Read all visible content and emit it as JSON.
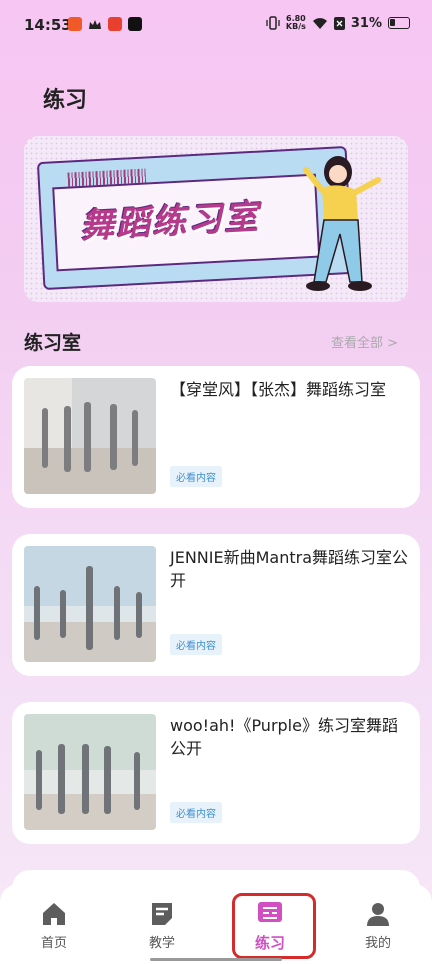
{
  "status_bar": {
    "time": "14:53",
    "net_speed_value": "6.80",
    "net_speed_unit": "KB/s",
    "battery": "31%"
  },
  "page": {
    "title": "练习"
  },
  "banner": {
    "text": "舞蹈练习室"
  },
  "section": {
    "title": "练习室",
    "view_all": "查看全部 >"
  },
  "cards": [
    {
      "title": "【穿堂风】【张杰】舞蹈练习室",
      "tag": "必看内容"
    },
    {
      "title": "JENNIE新曲Mantra舞蹈练习室公开",
      "tag": "必看内容"
    },
    {
      "title": "woo!ah!《Purple》练习室舞蹈公开",
      "tag": "必看内容"
    }
  ],
  "nav": {
    "items": [
      {
        "label": "首页",
        "icon": "home-icon"
      },
      {
        "label": "教学",
        "icon": "document-icon"
      },
      {
        "label": "练习",
        "icon": "practice-icon"
      },
      {
        "label": "我的",
        "icon": "profile-icon"
      }
    ],
    "active": "练习",
    "active_color": "#d14fc3"
  }
}
